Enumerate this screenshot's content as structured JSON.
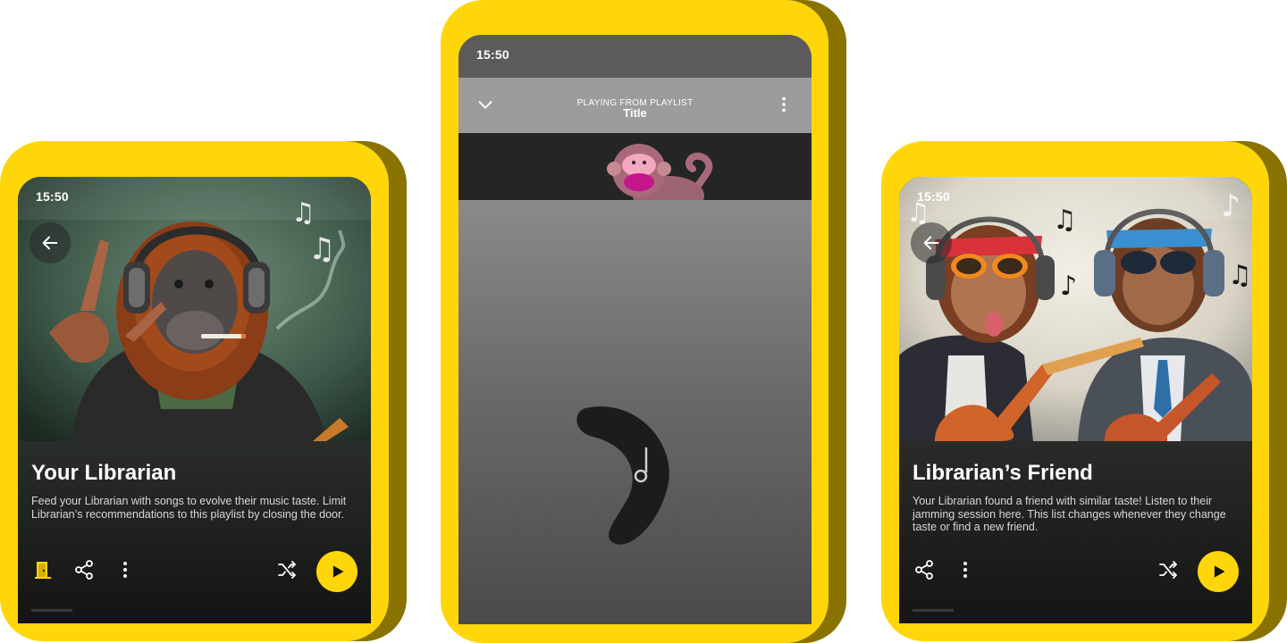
{
  "phones": {
    "left": {
      "status_time": "15:50",
      "title": "Your Librarian",
      "description": "Feed your Librarian with songs to evolve their music taste. Limit Librarian’s recommendations to this playlist by closing the door."
    },
    "center": {
      "status_time": "15:50",
      "header_subtitle": "PLAYING FROM PLAYLIST",
      "header_title": "Title"
    },
    "right": {
      "status_time": "15:50",
      "title": "Librarian’s Friend",
      "description": "Your Librarian found a friend with similar taste! Listen to their jamming session here. This list changes whenever they change taste or find a new friend."
    }
  },
  "colors": {
    "accent": "#ffd60a",
    "accent_shadow": "#8a7200",
    "screen_dark": "#1f211f",
    "header_gray": "#9c9c9c"
  },
  "icons": {
    "left_actions": [
      "door-icon",
      "share-icon",
      "more-vertical-icon",
      "shuffle-icon",
      "play-icon"
    ],
    "center_header": [
      "chevron-down-icon",
      "more-vertical-icon"
    ],
    "right_actions": [
      "share-icon",
      "more-vertical-icon",
      "shuffle-icon",
      "play-icon"
    ]
  }
}
